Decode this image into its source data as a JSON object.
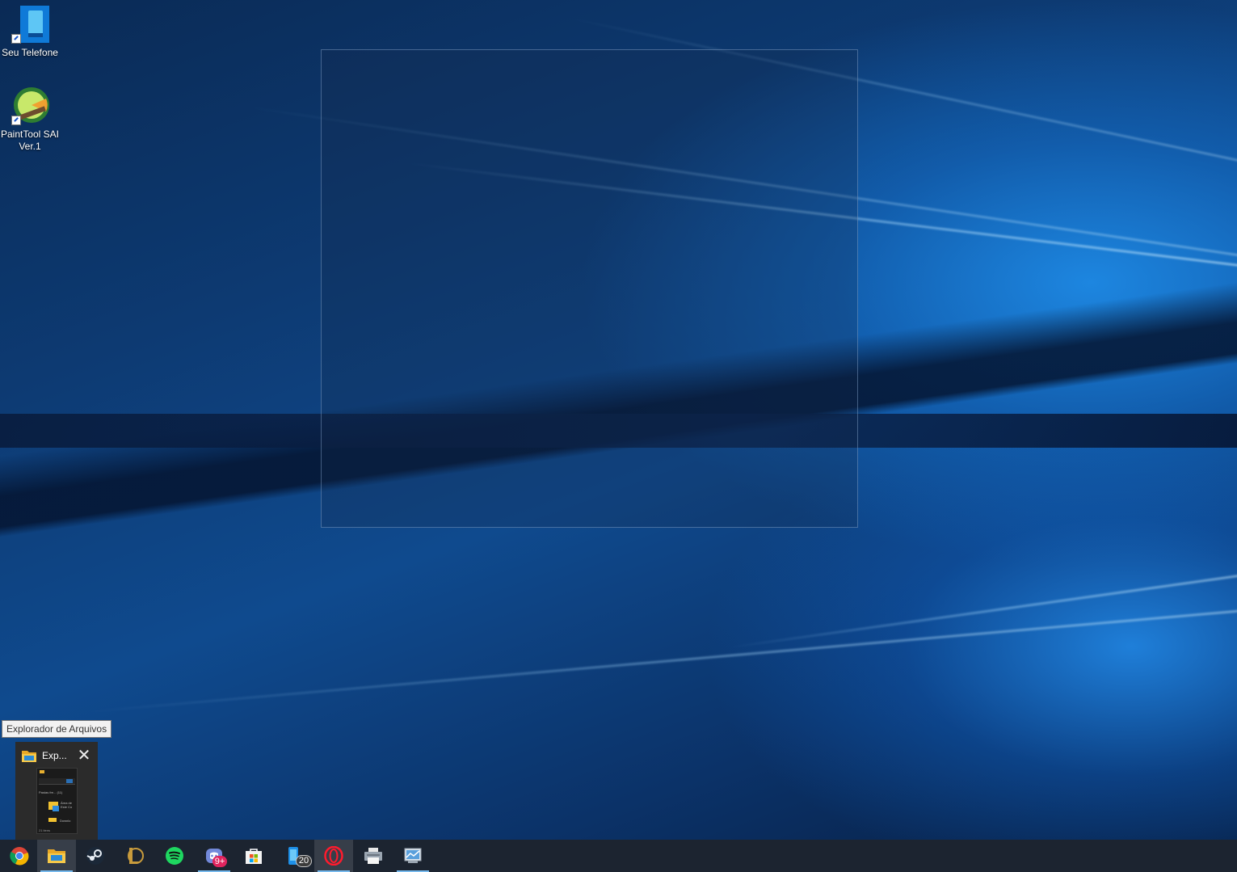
{
  "desktop": {
    "icons": [
      {
        "label": "Seu Telefone",
        "icon": "phone-app-icon"
      },
      {
        "label": "PaintTool SAI\nVer.1",
        "label_line1": "PaintTool SAI",
        "label_line2": "Ver.1",
        "icon": "painttool-sai-icon"
      }
    ]
  },
  "tooltip": {
    "text": "Explorador de Arquivos"
  },
  "thumbnail": {
    "title": "Exp...",
    "close_glyph": "✕",
    "preview_lines": [
      "Pastas fre... (11)",
      "Área de",
      "Este Co",
      "Downlo",
      "21 itens"
    ]
  },
  "taskbar": {
    "items": [
      {
        "name": "chrome",
        "icon": "chrome-icon"
      },
      {
        "name": "file-explorer",
        "icon": "folder-icon"
      },
      {
        "name": "steam",
        "icon": "steam-icon"
      },
      {
        "name": "league-of-legends",
        "icon": "league-icon"
      },
      {
        "name": "spotify",
        "icon": "spotify-icon"
      },
      {
        "name": "discord",
        "icon": "discord-icon",
        "badge": "9+"
      },
      {
        "name": "microsoft-store",
        "icon": "store-icon"
      },
      {
        "name": "your-phone",
        "icon": "phone-icon",
        "badge": "20"
      },
      {
        "name": "opera",
        "icon": "opera-icon"
      },
      {
        "name": "printer",
        "icon": "printer-icon"
      },
      {
        "name": "control-panel",
        "icon": "control-panel-icon"
      }
    ]
  },
  "colors": {
    "taskbar": "#1c2430",
    "accent_underline": "#76b9ed",
    "desktop_blue": "#0f4a8e"
  }
}
